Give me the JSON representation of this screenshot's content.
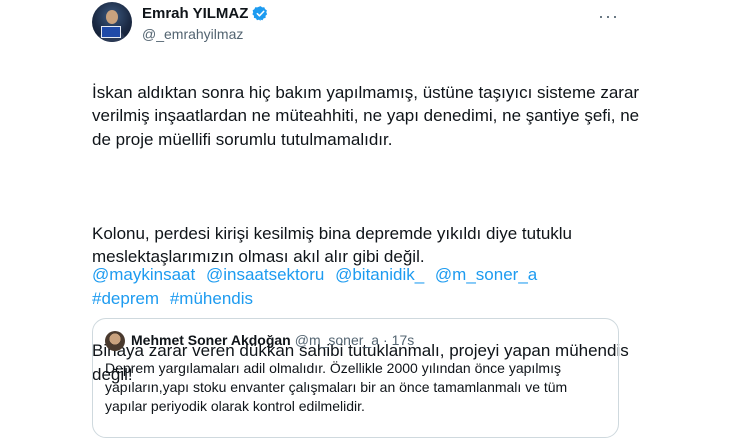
{
  "author": {
    "name": "Emrah YILMAZ",
    "handle": "@_emrahyilmaz",
    "verified_icon": "verified-badge-icon"
  },
  "menu": {
    "more_label": "···"
  },
  "tweet": {
    "paragraph1": "İskan aldıktan sonra hiç bakım yapılmamış, üstüne taşıyıcı sisteme zarar verilmiş inşaatlardan ne müteahhiti, ne yapı denedimi, ne şantiye şefi, ne de proje müellifi sorumlu tutulmamalıdır.",
    "paragraph2": "Kolonu, perdesi kirişi kesilmiş bina depremde yıkıldı diye tutuklu meslektaşlarımızın olması akıl alır gibi değil.",
    "paragraph3": "Binaya zarar veren dükkan sahibi tutuklanmalı, projeyi yapan mühendis değil!",
    "mentions": [
      "@maykinsaat",
      "@insaatsektoru",
      "@bitanidik_",
      "@m_soner_a"
    ],
    "hashtags": [
      "#deprem",
      "#mühendis"
    ]
  },
  "quote": {
    "name": "Mehmet Soner Akdoğan",
    "handle": "@m_soner_a",
    "separator": "·",
    "time": "17s",
    "text": "Deprem yargılamaları adil olmalıdır. Özellikle 2000 yılından önce yapılmış yapıların,yapı stoku envanter çalışmaları bir an önce tamamlanmalı ve tüm yapılar periyodik olarak kontrol edilmelidir."
  },
  "colors": {
    "link": "#1d9bf0",
    "secondary_text": "#536471",
    "border": "#cfd9de"
  }
}
